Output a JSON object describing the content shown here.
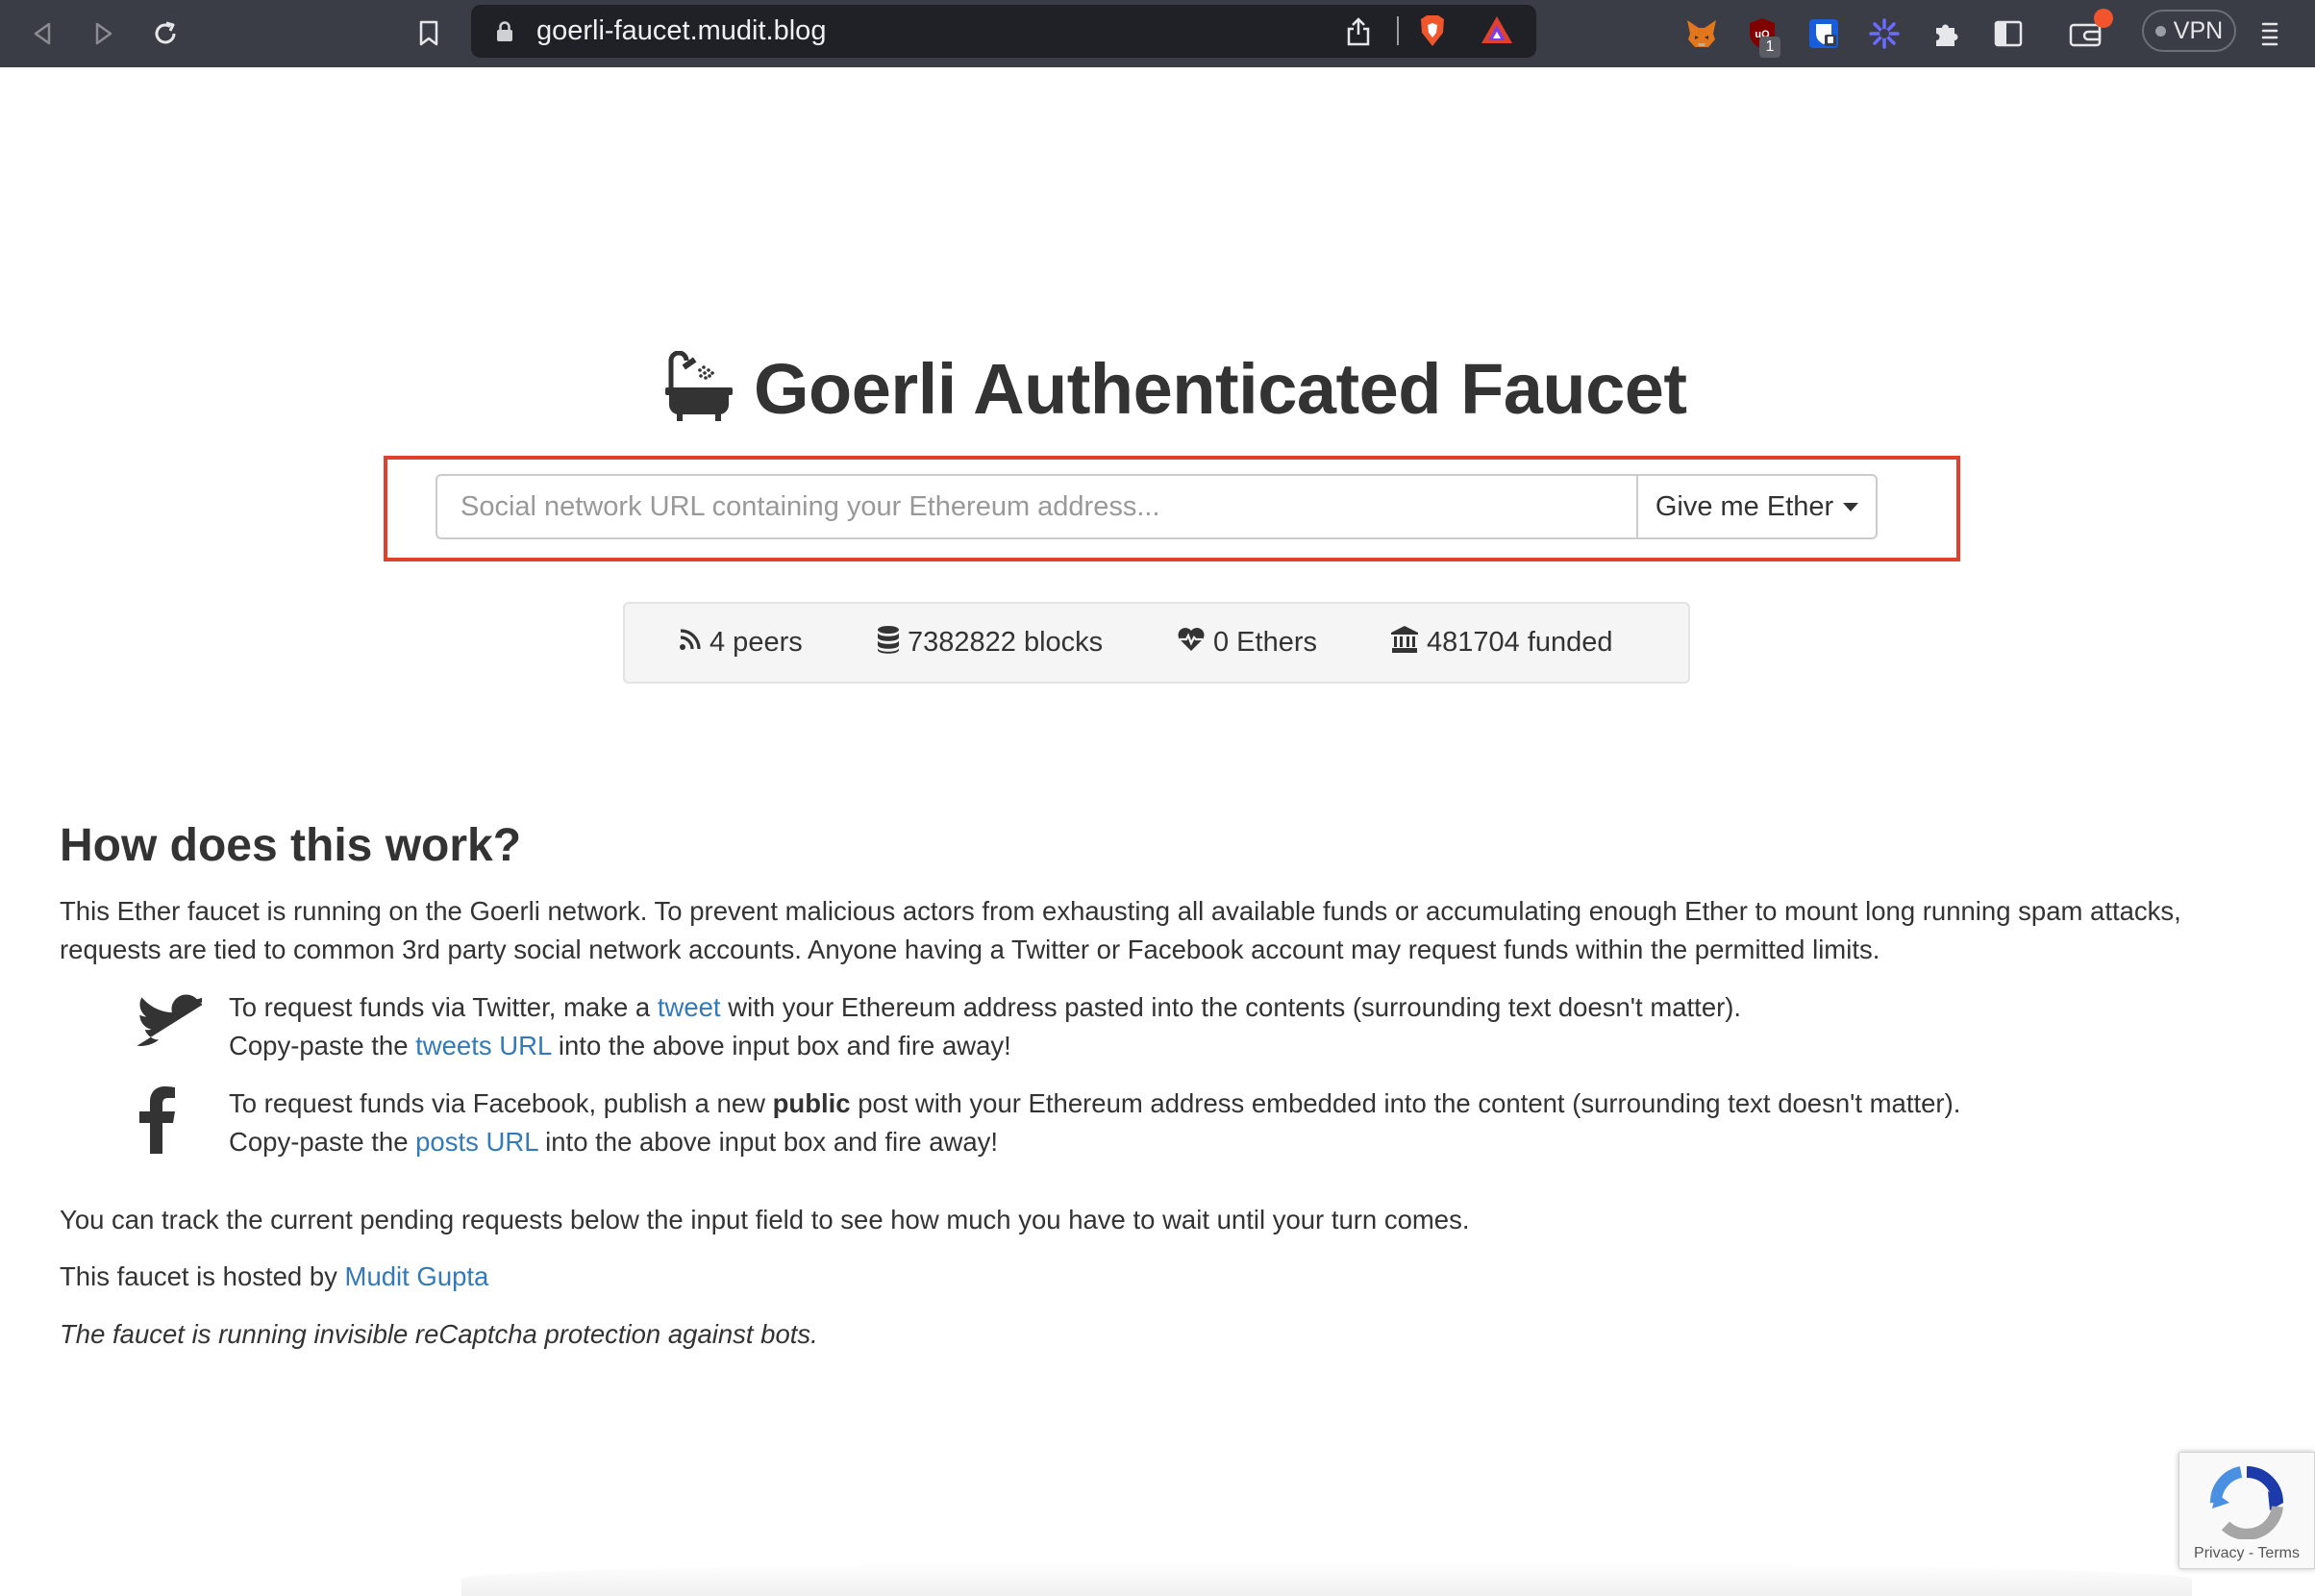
{
  "browser": {
    "url": "goerli-faucet.mudit.blog",
    "vpn_label": "VPN",
    "extension_badge": "1",
    "icons": [
      "back-icon",
      "forward-icon",
      "reload-icon",
      "bookmark-icon",
      "lock-icon",
      "share-icon",
      "brave-shields-icon",
      "brave-rewards-icon",
      "metamask-icon",
      "ublock-icon",
      "bitwarden-icon",
      "extension-sparkle-icon",
      "puzzle-icon",
      "sidebar-icon",
      "wallet-icon",
      "menu-icon"
    ]
  },
  "page": {
    "title": "Goerli Authenticated Faucet",
    "input_placeholder": "Social network URL containing your Ethereum address...",
    "give_button": "Give me Ether",
    "stats": {
      "peers": "4 peers",
      "blocks": "7382822 blocks",
      "ethers": "0 Ethers",
      "funded": "481704 funded"
    },
    "how_heading": "How does this work?",
    "intro_line1": "This Ether faucet is running on the Goerli network. To prevent malicious actors from exhausting all available funds or accumulating enough Ether to mount long running spam attacks,",
    "intro_line2": "requests are tied to common 3rd party social network accounts. Anyone having a Twitter or Facebook account may request funds within the permitted limits.",
    "twitter": {
      "line1_pre": "To request funds via Twitter, make a ",
      "line1_link": "tweet",
      "line1_post": " with your Ethereum address pasted into the contents (surrounding text doesn't matter).",
      "line2_pre": "Copy-paste the ",
      "line2_link": "tweets URL",
      "line2_post": " into the above input box and fire away!"
    },
    "facebook": {
      "line1_pre": "To request funds via Facebook, publish a new ",
      "line1_bold": "public",
      "line1_post": " post with your Ethereum address embedded into the content (surrounding text doesn't matter).",
      "line2_pre": "Copy-paste the ",
      "line2_link": "posts URL",
      "line2_post": " into the above input box and fire away!"
    },
    "track_text": "You can track the current pending requests below the input field to see how much you have to wait until your turn comes.",
    "hosted_pre": "This faucet is hosted by ",
    "hosted_link": "Mudit Gupta",
    "recaptcha_note": "The faucet is running invisible reCaptcha protection against bots.",
    "recaptcha_badge": "Privacy - Terms"
  },
  "colors": {
    "toolbar": "#3a3d45",
    "link": "#337ab7",
    "highlight_border": "#e0412e"
  }
}
